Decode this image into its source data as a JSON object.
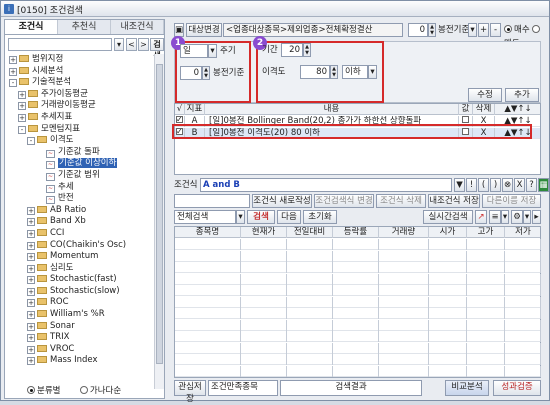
{
  "window": {
    "icon_text": "i",
    "title": "[0150] 조건검색"
  },
  "left": {
    "tabs": [
      "조건식",
      "추천식",
      "내조건식"
    ],
    "search": {
      "value": "",
      "prev_label": "<",
      "next_label": ">",
      "search_label": "검색"
    },
    "tree": [
      {
        "level": 0,
        "type": "folder",
        "exp": "+",
        "label": "범위지정"
      },
      {
        "level": 0,
        "type": "folder",
        "exp": "+",
        "label": "시세분석"
      },
      {
        "level": 0,
        "type": "folder",
        "exp": "-",
        "label": "기술적분석"
      },
      {
        "level": 1,
        "type": "folder",
        "exp": "+",
        "label": "주가이동평균"
      },
      {
        "level": 1,
        "type": "folder",
        "exp": "+",
        "label": "거래량이동평균"
      },
      {
        "level": 1,
        "type": "folder",
        "exp": "+",
        "label": "추세지표"
      },
      {
        "level": 1,
        "type": "folder",
        "exp": "-",
        "label": "모멘텀지표"
      },
      {
        "level": 2,
        "type": "folder",
        "exp": "-",
        "label": "이격도"
      },
      {
        "level": 3,
        "type": "doc",
        "exp": "",
        "label": "기준값 돌파"
      },
      {
        "level": 3,
        "type": "doc",
        "exp": "",
        "label": "기준값 이상이하",
        "selected": true
      },
      {
        "level": 3,
        "type": "doc",
        "exp": "",
        "label": "기준값 범위"
      },
      {
        "level": 3,
        "type": "doc",
        "exp": "",
        "label": "추세"
      },
      {
        "level": 3,
        "type": "doc",
        "exp": "",
        "label": "반전"
      },
      {
        "level": 2,
        "type": "folder",
        "exp": "+",
        "label": "AB Ratio"
      },
      {
        "level": 2,
        "type": "folder",
        "exp": "+",
        "label": "Band Xb"
      },
      {
        "level": 2,
        "type": "folder",
        "exp": "+",
        "label": "CCI"
      },
      {
        "level": 2,
        "type": "folder",
        "exp": "+",
        "label": "CO(Chaikin's Osc)"
      },
      {
        "level": 2,
        "type": "folder",
        "exp": "+",
        "label": "Momentum"
      },
      {
        "level": 2,
        "type": "folder",
        "exp": "+",
        "label": "심리도"
      },
      {
        "level": 2,
        "type": "folder",
        "exp": "+",
        "label": "Stochastic(fast)"
      },
      {
        "level": 2,
        "type": "folder",
        "exp": "+",
        "label": "Stochastic(slow)"
      },
      {
        "level": 2,
        "type": "folder",
        "exp": "+",
        "label": "ROC"
      },
      {
        "level": 2,
        "type": "folder",
        "exp": "+",
        "label": "William's %R"
      },
      {
        "level": 2,
        "type": "folder",
        "exp": "+",
        "label": "Sonar"
      },
      {
        "level": 2,
        "type": "folder",
        "exp": "+",
        "label": "TRIX"
      },
      {
        "level": 2,
        "type": "folder",
        "exp": "+",
        "label": "VROC"
      },
      {
        "level": 2,
        "type": "folder",
        "exp": "+",
        "label": "Mass Index"
      }
    ],
    "radio_sort": {
      "option1": "분류별",
      "option2": "가나다순"
    }
  },
  "top": {
    "target_change": "대상변경",
    "target_text": "<업종대상종목>제외업종>전체확정결산",
    "bong_value": "0",
    "bong_label": "봉전기준",
    "plus": "+",
    "minus": "-",
    "buy": "매수",
    "sell": "매도"
  },
  "params": {
    "badge1": "1",
    "badge2": "2",
    "period_value": "일",
    "period_label": "주기",
    "bong_value": "0",
    "bong_label": "봉전기준",
    "len_label": "기간",
    "len_value": "20",
    "disp_label": "이격도",
    "disp_value": "80",
    "compare": "이하"
  },
  "conditions": {
    "edit": "수정",
    "add": "추가",
    "headers": [
      "√",
      "지표",
      "내용",
      "값",
      "삭제",
      "▲▼↑↓"
    ],
    "rows": [
      {
        "checked": true,
        "id": "A",
        "content": "[일]0봉전 Bollinger Band(20,2) 종가가 하한선 상향돌파",
        "del": "X",
        "arrows": "▲▼↑↓"
      },
      {
        "checked": true,
        "id": "B",
        "content": "[일]0봉전 이격도(20) 80 이하",
        "del": "X",
        "arrows": "▲▼↑↓"
      }
    ],
    "formula_label": "조건식",
    "formula_value": "A and B",
    "ops": [
      "▼",
      "!",
      "(",
      ")",
      "⊗",
      "X",
      "?"
    ],
    "new": "조건식 새로작성",
    "change": "조건검색식 변경",
    "del": "조건식 삭제",
    "save": "내조건식 저장",
    "save_as": "다른이름 저장"
  },
  "results": {
    "scope": "전체검색",
    "search": "검색",
    "next": "다음",
    "reset": "초기화",
    "realtime": "실시간검색",
    "columns": [
      "종목명",
      "현재가",
      "전일대비",
      "등락률",
      "거래량",
      "시가",
      "고가",
      "저가"
    ]
  },
  "footer": {
    "interest": "관심저장",
    "match": "조건만족종목",
    "result": "검색결과",
    "compare": "비교분석",
    "perf": "성과검증"
  }
}
